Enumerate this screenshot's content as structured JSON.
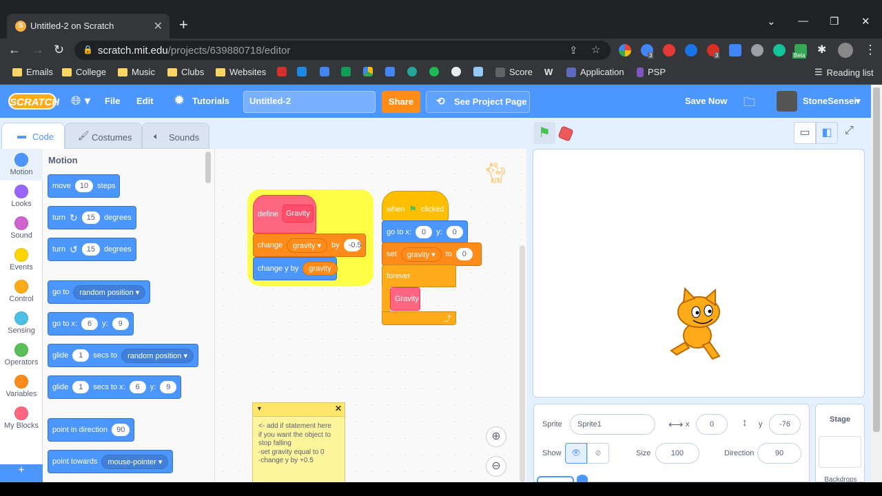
{
  "browser": {
    "tab_title": "Untitled-2 on Scratch",
    "url_host": "scratch.mit.edu",
    "url_path": "/projects/639880718/editor",
    "bookmarks": [
      "Emails",
      "College",
      "Music",
      "Clubs",
      "Websites",
      "Score",
      "Application",
      "PSP",
      "Reading list"
    ],
    "badges": [
      "3",
      "3",
      "Beta"
    ]
  },
  "menu": {
    "logo": "SCRATCH",
    "file": "File",
    "edit": "Edit",
    "tutorials": "Tutorials",
    "project_title": "Untitled-2",
    "share": "Share",
    "see_project": "See Project Page",
    "save_now": "Save Now",
    "username": "StoneSensei"
  },
  "tabs": {
    "code": "Code",
    "costumes": "Costumes",
    "sounds": "Sounds"
  },
  "categories": [
    {
      "label": "Motion",
      "color": "#4c97ff"
    },
    {
      "label": "Looks",
      "color": "#9966ff"
    },
    {
      "label": "Sound",
      "color": "#cf63cf"
    },
    {
      "label": "Events",
      "color": "#ffd500"
    },
    {
      "label": "Control",
      "color": "#ffab19"
    },
    {
      "label": "Sensing",
      "color": "#4cbfe6"
    },
    {
      "label": "Operators",
      "color": "#59c059"
    },
    {
      "label": "Variables",
      "color": "#ff8c1a"
    },
    {
      "label": "My Blocks",
      "color": "#ff6680"
    }
  ],
  "palette": {
    "heading": "Motion",
    "move": "move",
    "move_val": "10",
    "steps": "steps",
    "turn": "turn",
    "turn_val": "15",
    "degrees": "degrees",
    "goto": "go to",
    "random_position": "random position",
    "gotoxy": "go to x:",
    "x_val": "6",
    "y_label": "y:",
    "y_val": "9",
    "glide": "glide",
    "glide_val": "1",
    "secs_to": "secs to",
    "secs_to_x": "secs to x:",
    "point_dir": "point in direction",
    "dir_val": "90",
    "point_towards": "point towards",
    "mouse_pointer": "mouse-pointer"
  },
  "script": {
    "define": "define",
    "gravity_block": "Gravity",
    "change": "change",
    "gravity_var": "gravity",
    "by": "by",
    "by_val": "-0.5",
    "change_y": "change y by",
    "when": "when",
    "clicked": "clicked",
    "goto_x": "go to x:",
    "zero": "0",
    "y": "y:",
    "set": "set",
    "to": "to",
    "forever": "forever",
    "note": "<- add if statement here\nif you want the object to\nstop falling\n-set gravity equal to 0\n-change y by +0.5"
  },
  "sprite": {
    "sprite_label": "Sprite",
    "name": "Sprite1",
    "x_label": "x",
    "x": "0",
    "y_label": "y",
    "y": "-76",
    "show": "Show",
    "size_label": "Size",
    "size": "100",
    "direction_label": "Direction",
    "direction": "90",
    "stage": "Stage",
    "backdrops": "Backdrops"
  }
}
